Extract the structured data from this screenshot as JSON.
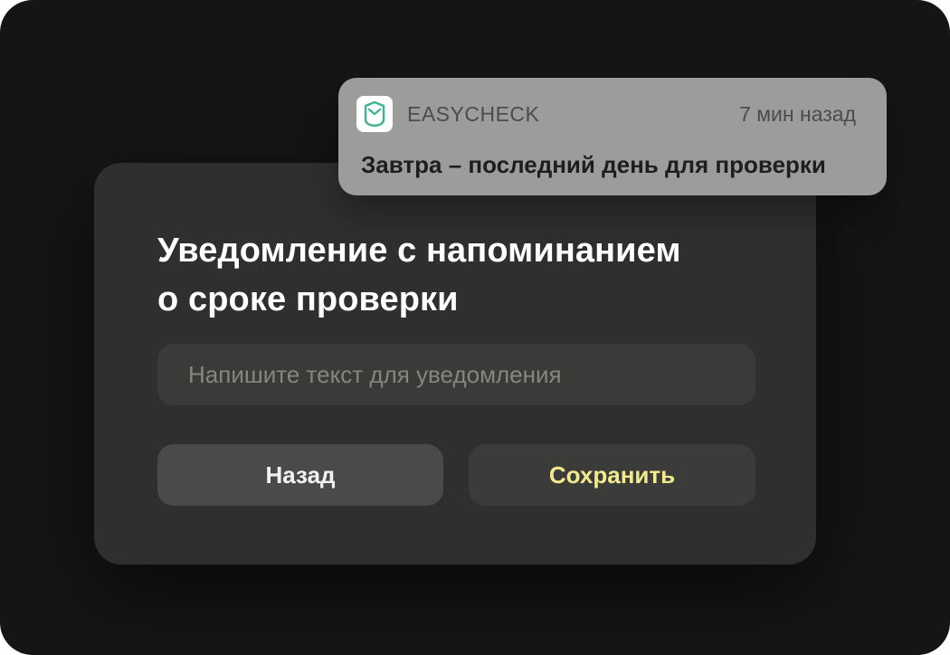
{
  "dialog": {
    "title_line1": "Уведомление с напоминанием",
    "title_line2": "о сроке проверки",
    "input": {
      "value": "",
      "placeholder": "Напишите текст для уведомления"
    },
    "back_label": "Назад",
    "save_label": "Сохранить"
  },
  "notification": {
    "app_icon": "easycheck-logo-icon",
    "app_name": "EASYCHECK",
    "time": "7 мин назад",
    "message": "Завтра – последний день для проверки"
  },
  "colors": {
    "background": "#141514",
    "dialog": "#2f302e",
    "save_accent": "#f4e98c",
    "brand_green": "#3fb291",
    "notification": "#9c9d9b"
  }
}
